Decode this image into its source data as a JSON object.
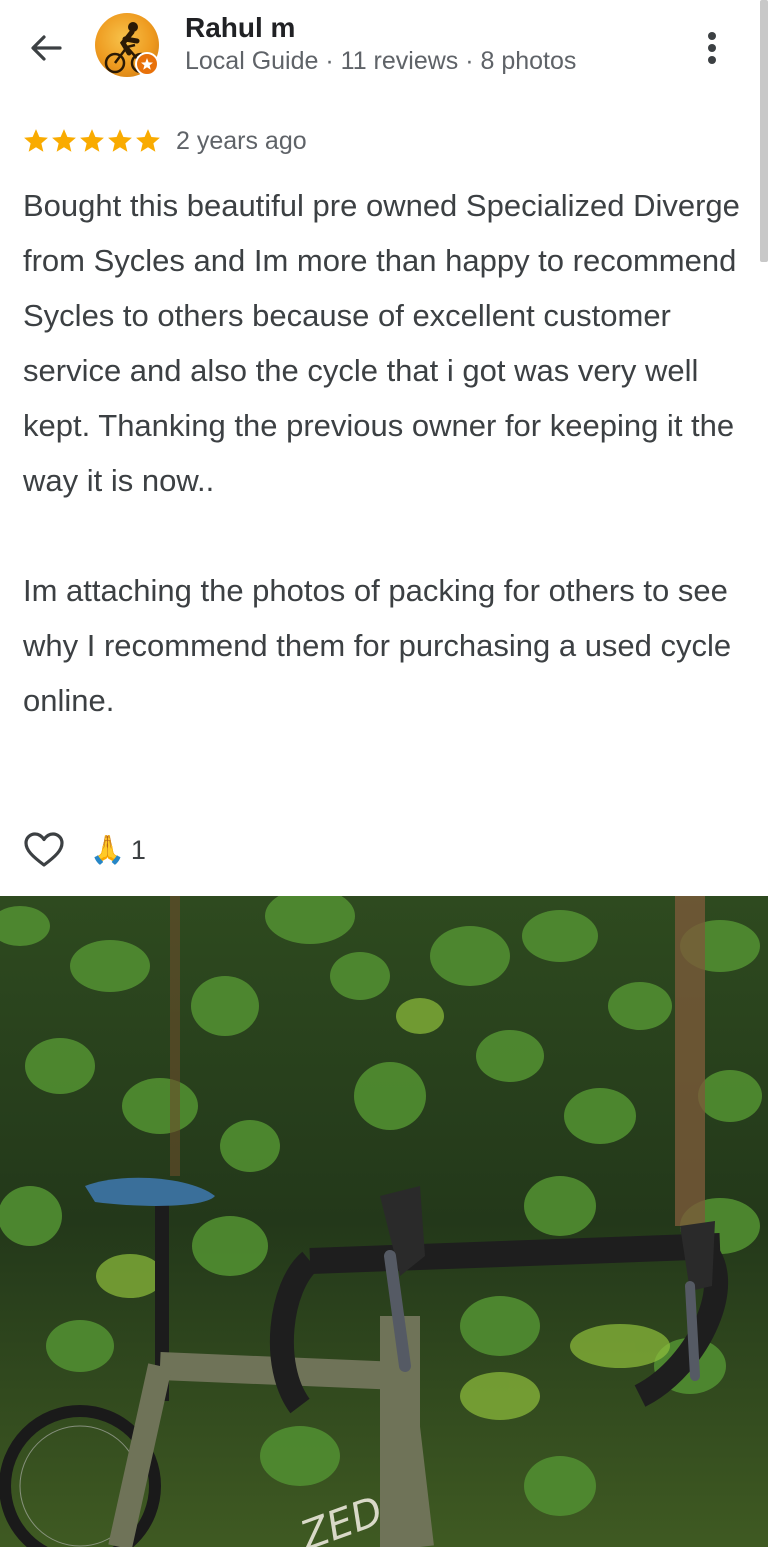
{
  "header": {
    "reviewer_name": "Rahul m",
    "reviewer_meta": "Local Guide · 11 reviews · 8 photos",
    "back_icon": "arrow-left-icon",
    "more_icon": "more-vert-icon"
  },
  "review": {
    "star_count": 5,
    "star_color": "#f9ab00",
    "date": "2 years ago",
    "paragraph1": "Bought this beautiful pre owned Specialized Diverge from Sycles and Im more than happy to recommend Sycles to others because of excellent customer service and also the cycle that i got was very well kept. Thanking the previous owner for keeping it the way it is now..",
    "paragraph2": "Im attaching the photos of packing for others to see why I recommend them for purchasing a used cycle online."
  },
  "reactions": {
    "like_icon": "heart-outline-icon",
    "emoji": "🙏",
    "count": "1"
  },
  "photo": {
    "description_icon": "review-photo",
    "frame_text": "ZED"
  }
}
